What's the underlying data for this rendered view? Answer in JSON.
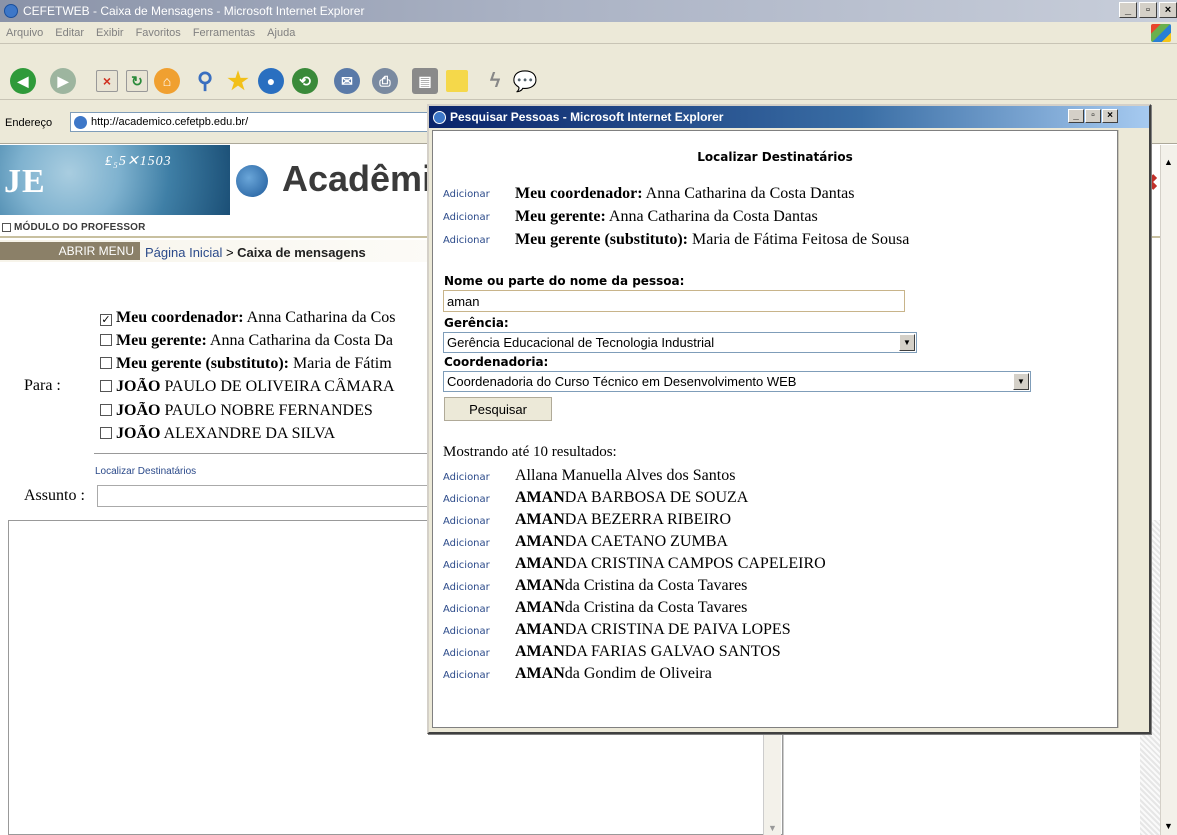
{
  "window": {
    "title": "CEFETWEB - Caixa de Mensagens - Microsoft Internet Explorer",
    "menu": [
      "Arquivo",
      "Editar",
      "Exibir",
      "Favoritos",
      "Ferramentas",
      "Ajuda"
    ],
    "address_label": "Endereço",
    "address_url": "http://academico.cefetpb.edu.br/",
    "chevron": "»"
  },
  "page": {
    "brand": "Acadêmi",
    "module": "MÓDULO DO PROFESSOR",
    "abrir_menu": "ABRIR MENU",
    "breadcrumb_home": "Página Inicial",
    "breadcrumb_sep": " > ",
    "breadcrumb_current": "Caixa de mensagens",
    "para_label": "Para :",
    "recipients": [
      {
        "checked": true,
        "bold_label": "Meu coordenador:",
        "name": " Anna Catharina da Cos"
      },
      {
        "checked": false,
        "bold_label": "Meu gerente:",
        "name": " Anna Catharina da Costa Da"
      },
      {
        "checked": false,
        "bold_label": "Meu gerente (substituto):",
        "name": " Maria de Fátim"
      },
      {
        "checked": false,
        "bold_label": "JOÃO",
        "name": " PAULO DE OLIVEIRA CÂMARA"
      },
      {
        "checked": false,
        "bold_label": "JOÃO",
        "name": " PAULO NOBRE FERNANDES"
      },
      {
        "checked": false,
        "bold_label": "JOÃO",
        "name": " ALEXANDRE DA SILVA"
      }
    ],
    "localizar_link": "Localizar Destinatários",
    "assunto_label": "Assunto :"
  },
  "popup": {
    "title": "Pesquisar Pessoas - Microsoft Internet Explorer",
    "heading": "Localizar Destinatários",
    "add_label": "Adicionar",
    "quick": [
      {
        "bold": "Meu coordenador:",
        "name": " Anna Catharina da Costa Dantas"
      },
      {
        "bold": "Meu gerente:",
        "name": " Anna Catharina da Costa Dantas"
      },
      {
        "bold": "Meu gerente (substituto):",
        "name": " Maria de Fátima Feitosa de Sousa"
      }
    ],
    "name_label": "Nome ou parte do nome da pessoa:",
    "name_value": "aman",
    "gerencia_label": "Gerência:",
    "gerencia_value": "Gerência Educacional de Tecnologia Industrial",
    "coord_label": "Coordenadoria:",
    "coord_value": "Coordenadoria do Curso Técnico em Desenvolvimento WEB",
    "search_button": "Pesquisar",
    "results_label": "Mostrando até 10 resultados:",
    "results": [
      {
        "bold": "",
        "rest": "Allana Manuella Alves dos Santos"
      },
      {
        "bold": "AMAN",
        "rest": "DA BARBOSA DE SOUZA"
      },
      {
        "bold": "AMAN",
        "rest": "DA BEZERRA RIBEIRO"
      },
      {
        "bold": "AMAN",
        "rest": "DA CAETANO ZUMBA"
      },
      {
        "bold": "AMAN",
        "rest": "DA CRISTINA CAMPOS CAPELEIRO"
      },
      {
        "bold": "AMAN",
        "rest": "da Cristina da Costa Tavares"
      },
      {
        "bold": "AMAN",
        "rest": "da Cristina da Costa Tavares"
      },
      {
        "bold": "AMAN",
        "rest": "DA CRISTINA DE PAIVA LOPES"
      },
      {
        "bold": "AMAN",
        "rest": "DA FARIAS GALVAO SANTOS"
      },
      {
        "bold": "AMAN",
        "rest": "da Gondim de Oliveira"
      }
    ]
  }
}
